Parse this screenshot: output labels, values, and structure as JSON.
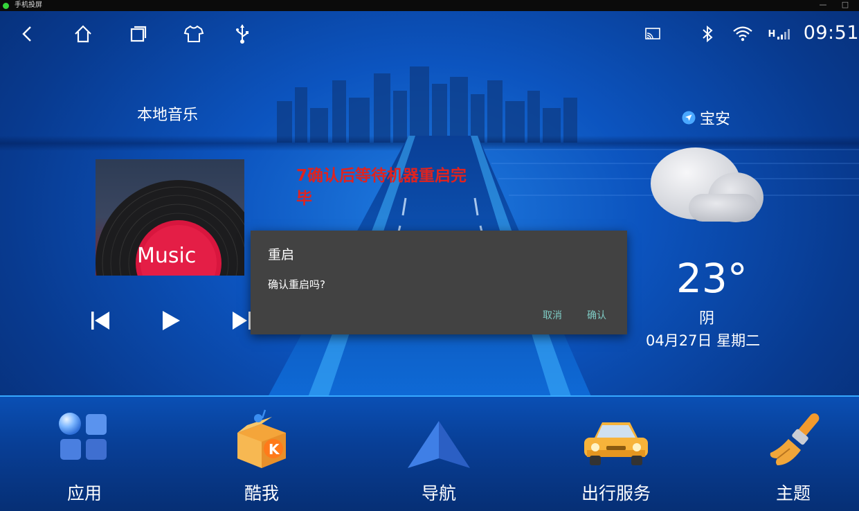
{
  "window": {
    "title": "手机投屏"
  },
  "status_bar": {
    "time": "09:51",
    "nav_icons": [
      "back-icon",
      "home-icon",
      "recents-icon",
      "shirt-icon",
      "usb-icon"
    ],
    "status_icons": [
      "cast-icon",
      "bluetooth-icon",
      "wifi-icon",
      "signal-icon"
    ],
    "signal_label": "H"
  },
  "music": {
    "title": "本地音乐",
    "album_text": "Music"
  },
  "annotation": {
    "text": "7确认后等待机器重启完毕",
    "color": "#e0231f"
  },
  "dialog": {
    "title": "重启",
    "message": "确认重启吗?",
    "cancel_label": "取消",
    "confirm_label": "确认",
    "button_color": "#7fcbc4"
  },
  "weather": {
    "location": "宝安",
    "temperature": "23°",
    "condition": "阴",
    "date": "04月27日 星期二"
  },
  "dock": [
    {
      "label": "应用",
      "icon": "apps-icon"
    },
    {
      "label": "酷我",
      "icon": "kuwo-icon"
    },
    {
      "label": "导航",
      "icon": "navigation-icon"
    },
    {
      "label": "出行服务",
      "icon": "car-icon"
    },
    {
      "label": "主题",
      "icon": "brush-icon"
    }
  ]
}
